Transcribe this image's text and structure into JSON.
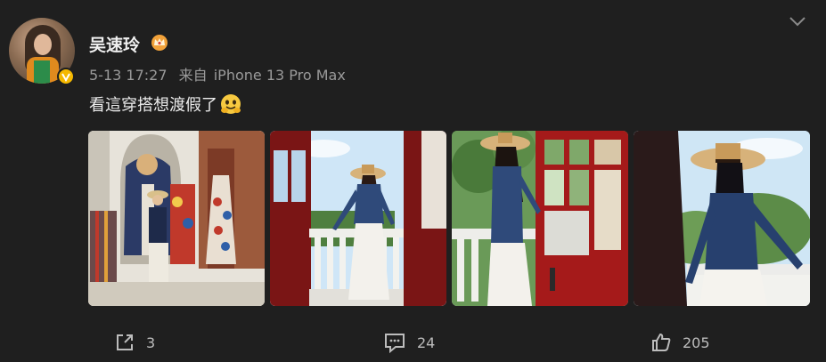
{
  "post": {
    "username": "吴速玲",
    "time": "5-13 17:27",
    "source_prefix": "来自",
    "source_device": "iPhone 13 Pro Max",
    "text": "看這穿搭想渡假了"
  },
  "actions": {
    "repost_count": "3",
    "comment_count": "24",
    "like_count": "205"
  },
  "icons": {
    "verified": "verified-badge-icon",
    "crown": "crown-icon",
    "menu": "chevron-down-icon",
    "emoji": "hugging-face-emoji",
    "repost": "share-icon",
    "comment": "comment-icon",
    "like": "thumbs-up-icon"
  },
  "colors": {
    "background": "#1f1f1f",
    "verified": "#f5b800",
    "accent_red": "#8c1414"
  }
}
